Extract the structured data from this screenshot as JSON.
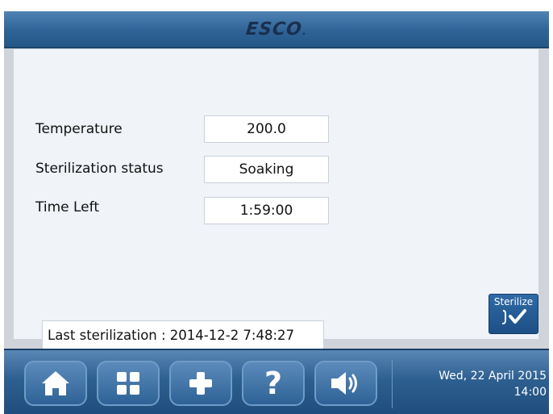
{
  "header": {
    "logo_text": "ESCO",
    "logo_suffix": "."
  },
  "fields": [
    {
      "label": "Temperature",
      "value": "200.0"
    },
    {
      "label": "Sterilization status",
      "value": "Soaking"
    },
    {
      "label": "Time Left",
      "value": "1:59:00"
    }
  ],
  "last_sterilization": "Last sterilization : 2014-12-2 7:48:27",
  "sterilize_button": {
    "label": "Sterilize",
    "icon": "check-icon"
  },
  "nav": {
    "icons": [
      "home-icon",
      "grid-icon",
      "plus-icon",
      "help-icon",
      "speaker-icon"
    ],
    "help_glyph": "?"
  },
  "status": {
    "date": "Wed, 22 April 2015",
    "time": "14:00"
  },
  "colors": {
    "header": "#2f6397",
    "panel": "#f0f3f8",
    "frame": "#d0d4da"
  }
}
